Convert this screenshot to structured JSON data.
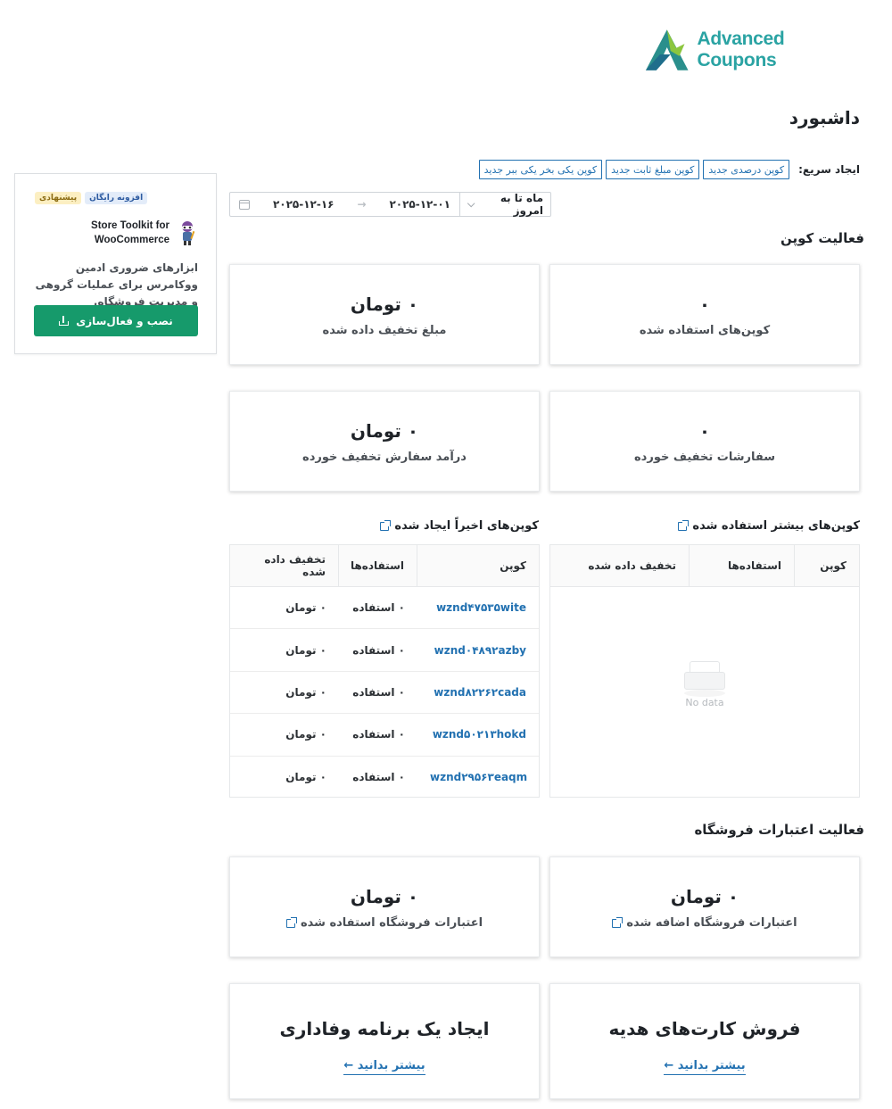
{
  "brand": {
    "name": "Advanced Coupons"
  },
  "page": {
    "title": "داشبورد"
  },
  "quick_create": {
    "label": "ایجاد سریع:",
    "buttons": [
      "کوپن درصدی جدید",
      "کوپن مبلغ ثابت جدید",
      "کوپن یکی بخر یکی ببر جدید"
    ]
  },
  "date_filter": {
    "period": "ماه تا به امروز",
    "start": "۲۰۲۵-۱۲-۰۱",
    "end": "۲۰۲۵-۱۲-۱۶"
  },
  "coupon_activity": {
    "title": "فعالیت کوپن",
    "cards": [
      {
        "value": "۰",
        "label": "کوپن‌های استفاده شده"
      },
      {
        "value": "۰ تومان",
        "label": "مبلغ تخفیف داده شده"
      },
      {
        "value": "۰",
        "label": "سفارشات تخفیف خورده"
      },
      {
        "value": "۰ تومان",
        "label": "درآمد سفارش تخفیف خورده"
      }
    ]
  },
  "top_coupons": {
    "title": "کوپن‌های بیشتر استفاده شده",
    "columns": [
      "کوپن",
      "استفاده‌ها",
      "تخفیف داده شده"
    ],
    "empty": "No data"
  },
  "recent_coupons": {
    "title": "کوپن‌های اخیراً ایجاد شده",
    "columns": [
      "کوپن",
      "استفاده‌ها",
      "تخفیف داده شده"
    ],
    "rows": [
      {
        "code": "wznd۴۷۵۳۵wite",
        "uses": "۰ استفاده",
        "discount": "۰ تومان"
      },
      {
        "code": "wznd۰۴۸۹۲azby",
        "uses": "۰ استفاده",
        "discount": "۰ تومان"
      },
      {
        "code": "wznd۸۲۲۶۲cada",
        "uses": "۰ استفاده",
        "discount": "۰ تومان"
      },
      {
        "code": "wznd۵۰۲۱۳hokd",
        "uses": "۰ استفاده",
        "discount": "۰ تومان"
      },
      {
        "code": "wznd۲۹۵۶۳eaqm",
        "uses": "۰ استفاده",
        "discount": "۰ تومان"
      }
    ]
  },
  "store_credit": {
    "title": "فعالیت اعتبارات فروشگاه",
    "cards": [
      {
        "value": "۰ تومان",
        "label": "اعتبارات فروشگاه اضافه شده"
      },
      {
        "value": "۰ تومان",
        "label": "اعتبارات فروشگاه استفاده شده"
      }
    ]
  },
  "promos": [
    {
      "title": "فروش کارت‌های هدیه",
      "link": "بیشتر بدانید ←"
    },
    {
      "title": "ایجاد یک برنامه وفاداری",
      "link": "بیشتر بدانید ←"
    }
  ],
  "widget": {
    "badges": [
      "افزونه رایگان",
      "پیشنهادی"
    ],
    "name_line1": "Store Toolkit for",
    "name_line2": "WooCommerce",
    "description": "ابزارهای ضروری ادمین ووکامرس برای عملیات گروهی و مدیریت فروشگاه.",
    "button": "نصب و فعال‌سازی"
  },
  "colors": {
    "accent": "#2271b1",
    "install": "#169a6b",
    "logo_teal": "#2aa3a3"
  }
}
